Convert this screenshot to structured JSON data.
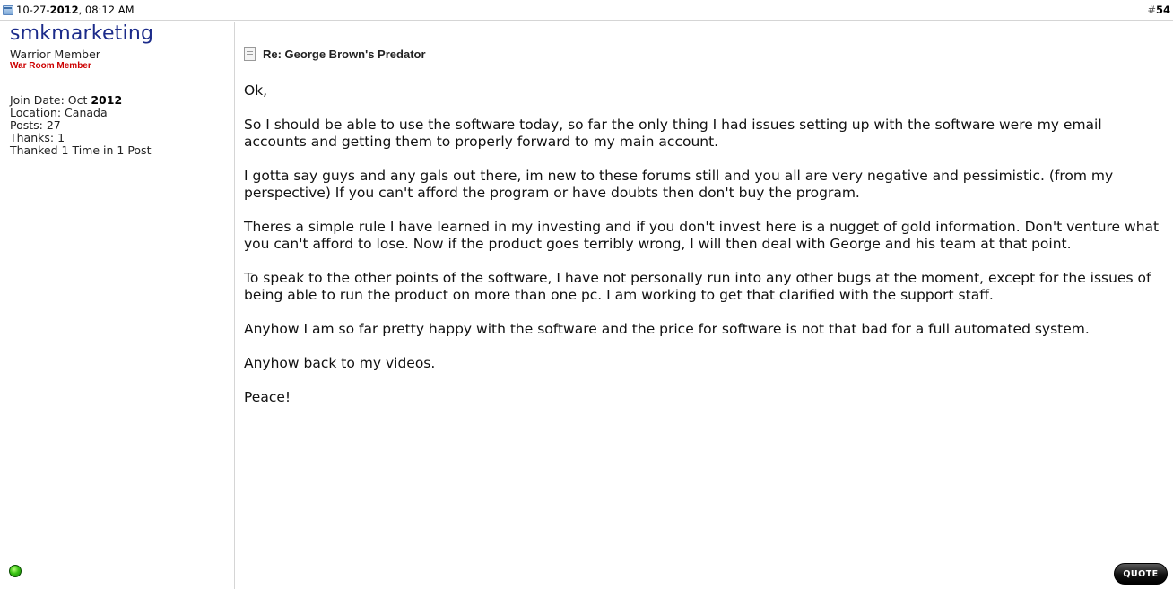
{
  "header": {
    "date_prefix": "10-27-",
    "date_year": "2012",
    "date_time": ", 08:12 AM",
    "post_hash": "#",
    "post_number": "54"
  },
  "user": {
    "name": "smkmarketing",
    "title": "Warrior Member",
    "rank": "War Room Member",
    "join_label": "Join Date: Oct ",
    "join_year": "2012",
    "location": "Location: Canada",
    "posts": "Posts: 27",
    "thanks": "Thanks: 1",
    "thanked": "Thanked 1 Time in 1 Post",
    "status": "online"
  },
  "post": {
    "title": "Re: George Brown's Predator",
    "paragraphs": [
      "Ok,",
      "So I should be able to use the software today, so far the only thing I had issues setting up with the software were my email accounts and getting them to properly forward to my main account.",
      "I gotta say guys and any gals out there, im new to these forums still and you all are very negative and pessimistic. (from my perspective) If you can't afford the program or have doubts then don't buy the program.",
      "Theres a simple rule I have learned in my investing and if you don't invest here is a nugget of gold information. Don't venture what you can't afford to lose. Now if the product goes terribly wrong, I will then deal with George and his team at that point.",
      "To speak to the other points of the software, I have not personally run into any other bugs at the moment, except for the issues of being able to run the product on more than one pc. I am working to get that clarified with the support staff.",
      "Anyhow I am so far pretty happy with the software and the price for software is not that bad for a full automated system.",
      "Anyhow back to my videos.",
      "Peace!"
    ],
    "quote_label": "QUOTE"
  }
}
